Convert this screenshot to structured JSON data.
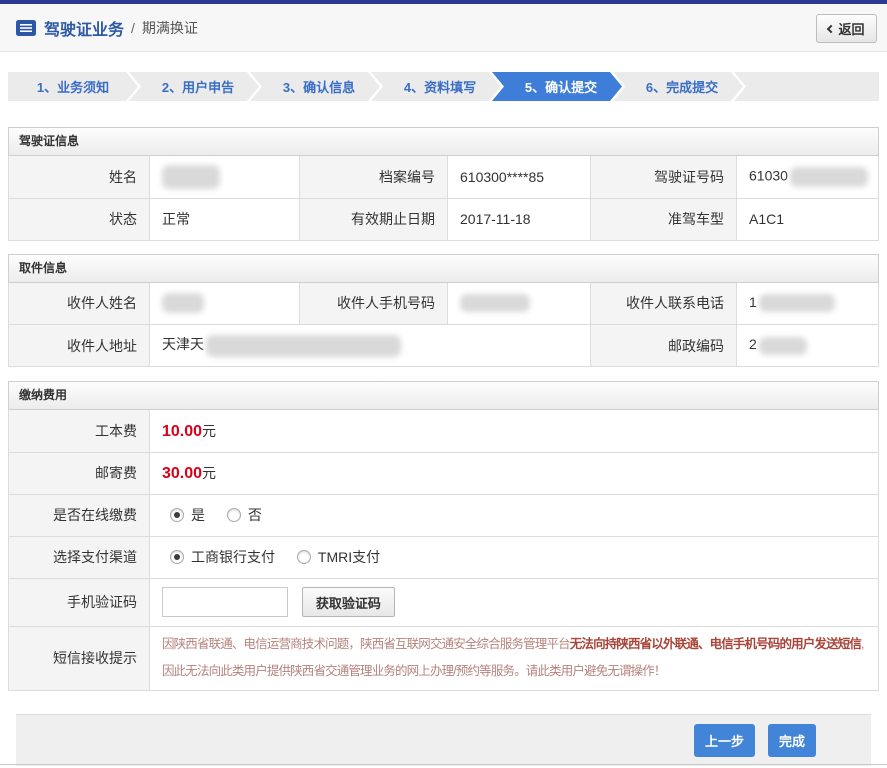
{
  "colors": {
    "accent_blue": "#3f7ed8",
    "top_bar": "#2b3a92",
    "fee_red": "#d9001b",
    "notice_red": "#b5837c",
    "notice_strong_red": "#a8453a"
  },
  "header": {
    "title": "驾驶证业务",
    "separator": "/",
    "subtitle": "期满换证",
    "back": "返回"
  },
  "steps": {
    "items": [
      {
        "label": "1、业务须知",
        "active": false
      },
      {
        "label": "2、用户申告",
        "active": false
      },
      {
        "label": "3、确认信息",
        "active": false
      },
      {
        "label": "4、资料填写",
        "active": false
      },
      {
        "label": "5、确认提交",
        "active": true
      },
      {
        "label": "6、完成提交",
        "active": false
      }
    ]
  },
  "license": {
    "title": "驾驶证信息",
    "name_label": "姓名",
    "name_redacted": true,
    "file_no_label": "档案编号",
    "file_no": "610300****85",
    "license_no_label": "驾驶证号码",
    "license_no_prefix": "61030",
    "license_no_redacted": true,
    "status_label": "状态",
    "status": "正常",
    "expiry_label": "有效期止日期",
    "expiry": "2017-11-18",
    "vehicle_label": "准驾车型",
    "vehicle": "A1C1"
  },
  "delivery": {
    "title": "取件信息",
    "recipient_label": "收件人姓名",
    "recipient_redacted": true,
    "mobile_label": "收件人手机号码",
    "mobile_redacted": true,
    "phone_label": "收件人联系电话",
    "phone_prefix": "1",
    "phone_redacted": true,
    "address_label": "收件人地址",
    "address_prefix": "天津天",
    "address_redacted": true,
    "zip_label": "邮政编码",
    "zip_prefix": "2",
    "zip_redacted": true
  },
  "fees": {
    "title": "缴纳费用",
    "work_fee_label": "工本费",
    "work_fee": "10.00",
    "mail_fee_label": "邮寄费",
    "mail_fee": "30.00",
    "unit": "元",
    "online_label": "是否在线缴费",
    "online_yes": "是",
    "online_yes_checked": true,
    "online_no": "否",
    "channel_label": "选择支付渠道",
    "channel_icbc": "工商银行支付",
    "channel_icbc_checked": true,
    "channel_tmri": "TMRI支付",
    "code_label": "手机验证码",
    "code_value": "",
    "get_code_button": "获取验证码",
    "notice_label": "短信接收提示",
    "notice_p1": "因陕西省联通、电信运营商技术问题，陕西省互联网交通安全综合服务管理平台",
    "notice_strong": "无法向持陕西省以外联通、电信手机号码的用户发送短信",
    "notice_p2": ",因此无法向此类用户提供陕西省交通管理业务的网上办理/预约等服务。请此类用户避免无谓操作！"
  },
  "footer": {
    "prev_button": "上一步",
    "finish_button": "完成"
  }
}
